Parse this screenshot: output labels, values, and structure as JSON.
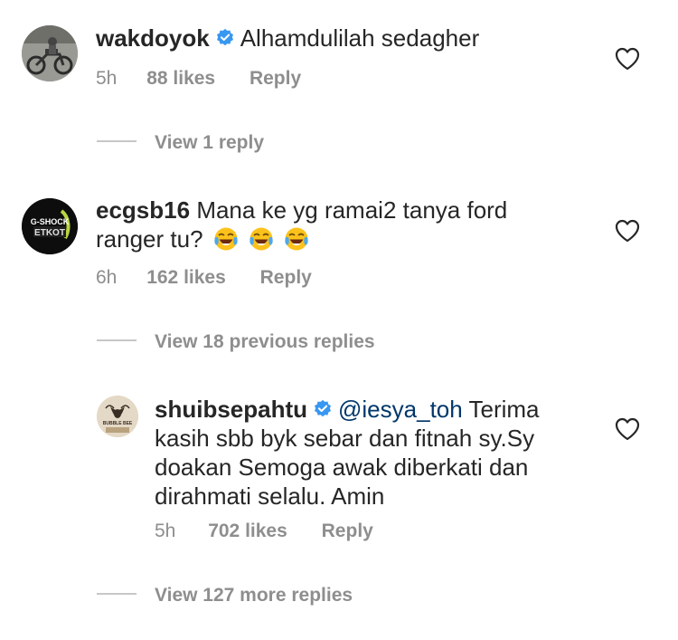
{
  "comments": [
    {
      "username": "wakdoyok",
      "verified": true,
      "text": "Alhamdulilah sedagher",
      "time": "5h",
      "likes": "88 likes",
      "reply": "Reply",
      "view_replies": "View 1 reply"
    },
    {
      "username": "ecgsb16",
      "verified": false,
      "text_line1": "Mana ke yg ramai2 tanya ford",
      "text_line2": "ranger tu?",
      "emoji": "face-with-tears-of-joy",
      "time": "6h",
      "likes": "162 likes",
      "reply": "Reply",
      "view_replies": "View 18 previous replies",
      "avatar_text_top": "G-SHOCK",
      "avatar_text_bottom": "ETKOT"
    },
    {
      "username": "shuibsepahtu",
      "verified": true,
      "mention": "@iesya_toh",
      "text_line1_rest": "Terima",
      "text_line2": "kasih sbb byk sebar dan fitnah sy.Sy",
      "text_line3": "doakan Semoga awak diberkati dan",
      "text_line4": "dirahmati selalu. Amin",
      "time": "5h",
      "likes": "702 likes",
      "reply": "Reply",
      "view_replies": "View 127 more replies",
      "avatar_text": "BUBBLE BEE"
    }
  ],
  "colors": {
    "primary_text": "#262626",
    "secondary_text": "#8e8e8e",
    "mention": "#00376b",
    "verified_badge": "#3897f0"
  }
}
